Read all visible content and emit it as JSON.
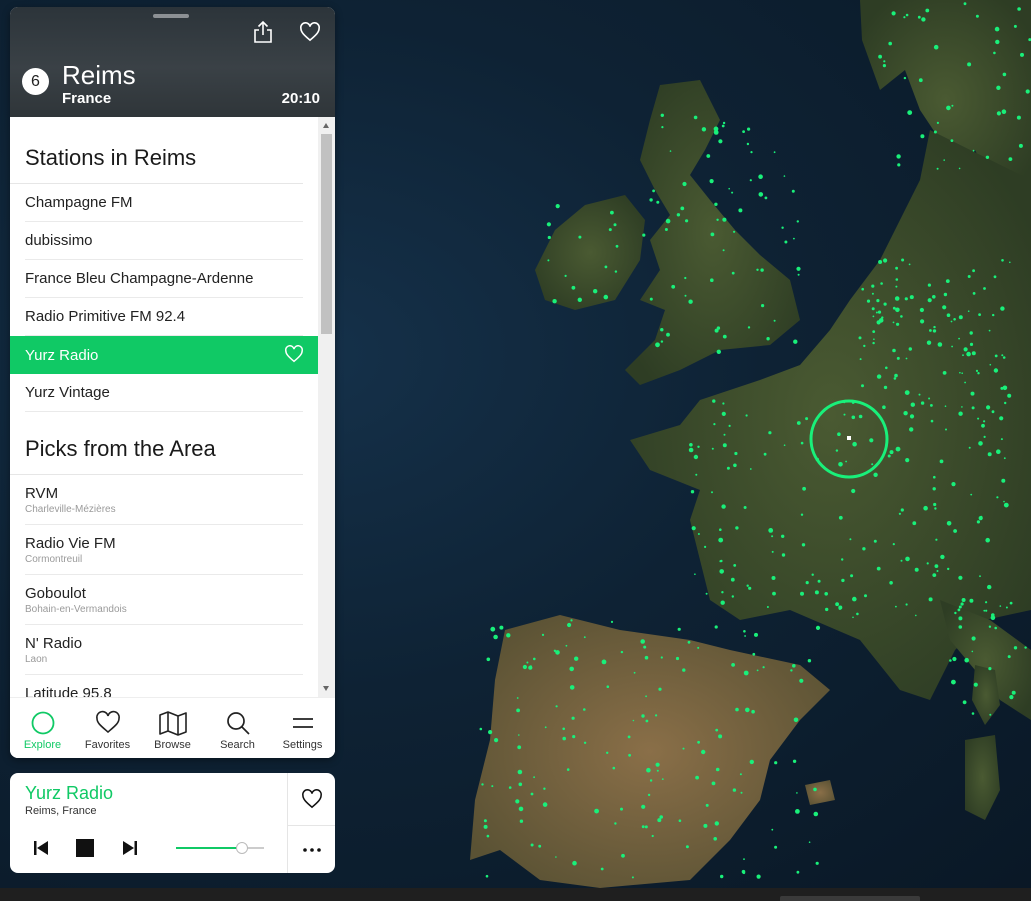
{
  "header": {
    "badge": "6",
    "city": "Reims",
    "country": "France",
    "time": "20:10",
    "share_icon": "share-icon",
    "favorite_icon": "heart-outline-icon"
  },
  "sections": {
    "stations_title": "Stations in Reims",
    "picks_title": "Picks from the Area"
  },
  "stations": [
    {
      "name": "Champagne FM"
    },
    {
      "name": "dubissimo"
    },
    {
      "name": "France Bleu Champagne-Ardenne"
    },
    {
      "name": "Radio Primitive FM 92.4"
    },
    {
      "name": "Yurz Radio",
      "active": true
    },
    {
      "name": "Yurz Vintage"
    }
  ],
  "picks": [
    {
      "name": "RVM",
      "location": "Charleville-Mézières"
    },
    {
      "name": "Radio Vie FM",
      "location": "Cormontreuil"
    },
    {
      "name": "Goboulot",
      "location": "Bohain-en-Vermandois"
    },
    {
      "name": "N' Radio",
      "location": "Laon"
    },
    {
      "name": "Latitude 95.8",
      "location": ""
    }
  ],
  "nav": [
    {
      "label": "Explore",
      "icon": "explore-circle-icon",
      "active": true
    },
    {
      "label": "Favorites",
      "icon": "heart-icon"
    },
    {
      "label": "Browse",
      "icon": "map-icon"
    },
    {
      "label": "Search",
      "icon": "search-icon"
    },
    {
      "label": "Settings",
      "icon": "menu-icon"
    }
  ],
  "player": {
    "title": "Yurz Radio",
    "subtitle": "Reims, France",
    "volume": 0.75
  },
  "colors": {
    "accent": "#10c965",
    "header_bg": "#33393e",
    "map_ocean": "#0e2234",
    "station_dot": "#19f07a"
  }
}
